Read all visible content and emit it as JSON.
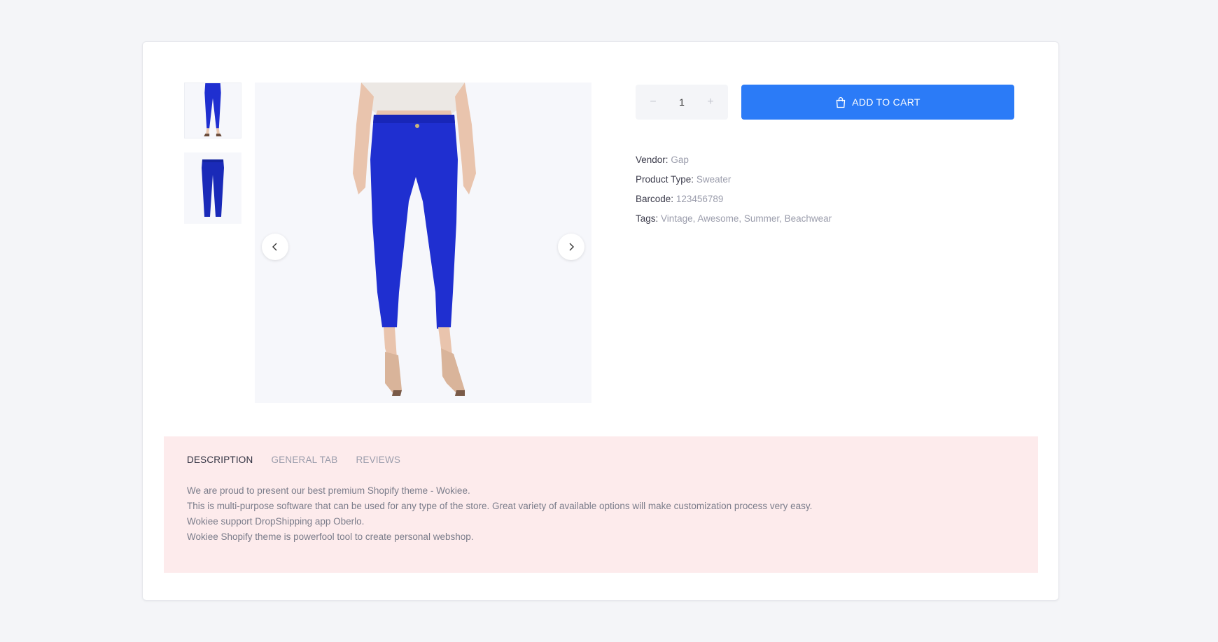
{
  "product": {
    "gallery": {
      "thumbnails": [
        {
          "icon": "jeans-front-thumbnail"
        },
        {
          "icon": "jeans-flat-thumbnail"
        }
      ],
      "main_image_icon": "blue-jeans-model-image",
      "prev_icon": "chevron-left-icon",
      "next_icon": "chevron-right-icon"
    },
    "quantity": {
      "value": "1",
      "minus": "−",
      "plus": "+"
    },
    "add_to_cart": {
      "label": "ADD TO CART",
      "icon": "shopping-bag-icon"
    },
    "meta": {
      "vendor": {
        "label": "Vendor:",
        "value": "Gap"
      },
      "product_type": {
        "label": "Product Type:",
        "value": "Sweater"
      },
      "barcode": {
        "label": "Barcode:",
        "value": "123456789"
      },
      "tags": {
        "label": "Tags:",
        "value": "Vintage, Awesome, Summer, Beachwear"
      }
    }
  },
  "tabs": {
    "items": [
      {
        "label": "DESCRIPTION",
        "active": true
      },
      {
        "label": "GENERAL TAB",
        "active": false
      },
      {
        "label": "REVIEWS",
        "active": false
      }
    ],
    "description": [
      "We are proud to present our best premium Shopify theme - Wokiee.",
      "This is multi-purpose software that can be used for any type of the store. Great variety of available options will make customization process very easy.",
      "Wokiee support DropShipping app Oberlo.",
      "Wokiee Shopify theme is powerfool tool to create personal webshop."
    ]
  },
  "colors": {
    "accent": "#2b7bf7",
    "tabs_background": "#fdebec",
    "jeans": "#1f2fd0"
  }
}
